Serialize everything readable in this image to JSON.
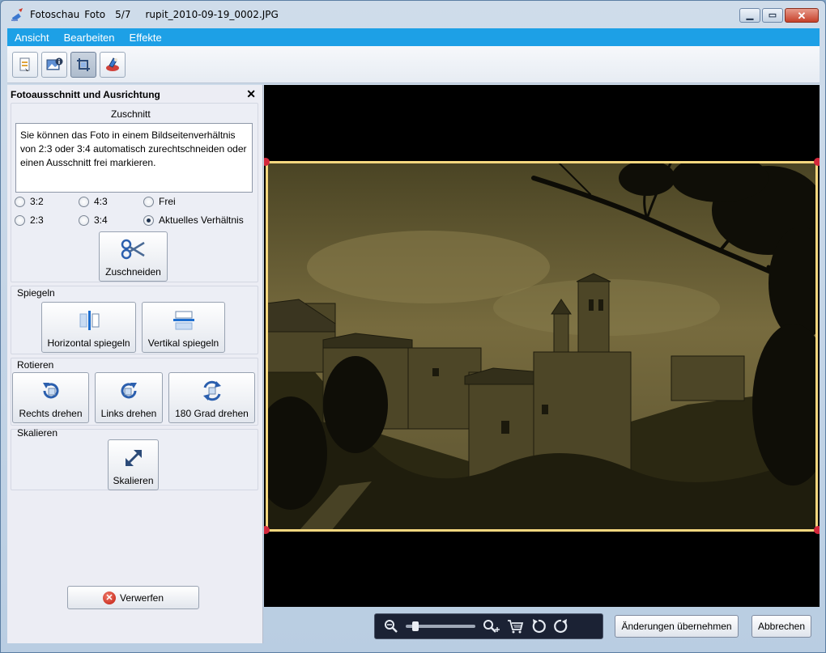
{
  "window": {
    "title_app": "Fotoschau",
    "title_mode": "Foto",
    "title_counter": "5/7",
    "title_file": "rupit_2010-09-19_0002.JPG"
  },
  "menu": [
    "Ansicht",
    "Bearbeiten",
    "Effekte"
  ],
  "toolbar": {
    "tools": [
      {
        "icon": "page-tool-icon"
      },
      {
        "icon": "image-info-icon"
      },
      {
        "icon": "crop-tool-icon",
        "active": true
      },
      {
        "icon": "color-tool-icon"
      }
    ]
  },
  "panel": {
    "title": "Fotoausschnitt und Ausrichtung",
    "close_symbol": "✕",
    "crop": {
      "label": "Zuschnitt",
      "description": "Sie können das Foto in einem Bildseitenverhältnis von 2:3 oder 3:4 automatisch zurechtschneiden oder einen Ausschnitt frei markieren.",
      "ratios": [
        "3:2",
        "4:3",
        "Frei",
        "2:3",
        "3:4",
        "Aktuelles Verhältnis"
      ],
      "selected": "Aktuelles Verhältnis",
      "button": "Zuschneiden"
    },
    "mirror": {
      "label": "Spiegeln",
      "horizontal": "Horizontal spiegeln",
      "vertical": "Vertikal spiegeln"
    },
    "rotate": {
      "label": "Rotieren",
      "right": "Rechts drehen",
      "left": "Links drehen",
      "half": "180 Grad drehen"
    },
    "scale": {
      "label": "Skalieren",
      "button": "Skalieren"
    },
    "discard": "Verwerfen"
  },
  "footer": {
    "apply": "Änderungen übernehmen",
    "cancel": "Abbrechen"
  },
  "colors": {
    "menu_bg": "#1da0e6",
    "crop_frame": "#f6d77e",
    "crop_handle": "#d4283c",
    "photo_tone": "#6b5f34"
  }
}
